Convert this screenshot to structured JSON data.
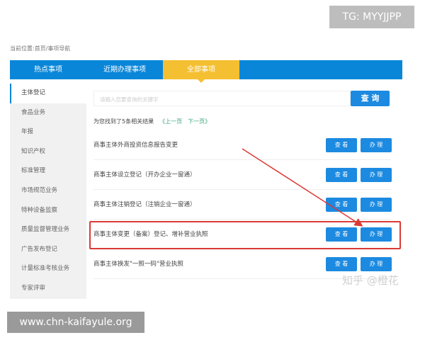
{
  "breadcrumb": "当前位置:首页/事项导航",
  "tabs": [
    {
      "label": "热点事项"
    },
    {
      "label": "近期办理事项"
    },
    {
      "label": "全部事项",
      "active": true
    }
  ],
  "sidebar": {
    "items": [
      {
        "label": "主体登记",
        "active": true
      },
      {
        "label": "食品业务"
      },
      {
        "label": "年报"
      },
      {
        "label": "知识产权"
      },
      {
        "label": "标准管理"
      },
      {
        "label": "市场规范业务"
      },
      {
        "label": "特种设备监察"
      },
      {
        "label": "质量监督管理业务"
      },
      {
        "label": "广告发布登记"
      },
      {
        "label": "计量标准考核业务"
      },
      {
        "label": "专家评审"
      }
    ]
  },
  "search": {
    "placeholder": "请输入您要查询的关键字",
    "button": "查 询"
  },
  "results": {
    "summary": "为您找到了5条相关结果",
    "prev": "《上一页",
    "next": "下一页》"
  },
  "rows": [
    {
      "title": "商事主体外商投资信息报告变更",
      "view": "查 看",
      "handle": "办 理"
    },
    {
      "title": "商事主体设立登记（开办企业一窗通）",
      "view": "查 看",
      "handle": "办 理"
    },
    {
      "title": "商事主体注销登记（注销企业一窗通）",
      "view": "查 看",
      "handle": "办 理"
    },
    {
      "title": "商事主体变更（备案）登记、增补营业执照",
      "view": "查 看",
      "handle": "办 理",
      "highlighted": true
    },
    {
      "title": "商事主体换发\"一照一码\"营业执照",
      "view": "查 看",
      "handle": "办 理"
    }
  ],
  "watermarks": {
    "tg": "TG: MYYJJPP",
    "site": "www.chn-kaifayule.org",
    "zhihu": "知乎 @橙花"
  },
  "colors": {
    "primary": "#0a86d9",
    "active_tab": "#f5bf32",
    "highlight": "#d93a35"
  }
}
